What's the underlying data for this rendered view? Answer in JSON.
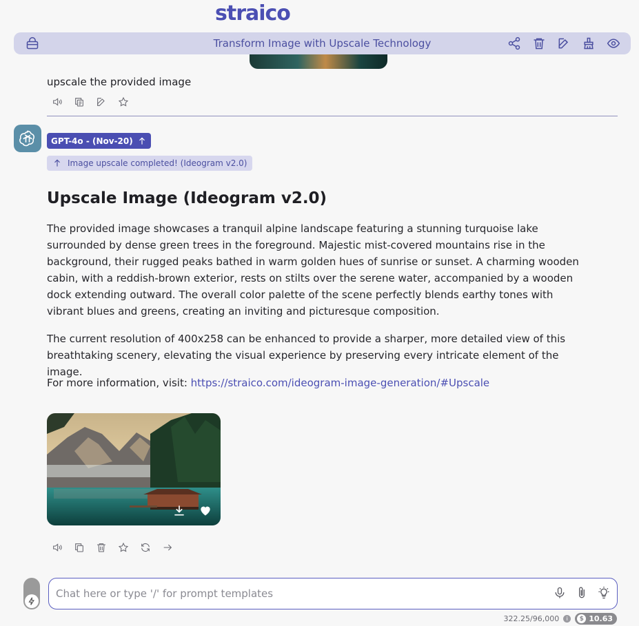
{
  "brand": "straico",
  "header": {
    "title": "Transform Image with Upscale Technology",
    "actions": [
      "share-icon",
      "trash-icon",
      "edit-icon",
      "broom-icon",
      "eye-icon"
    ]
  },
  "user_message": {
    "text": "upscale the provided image",
    "tools": [
      "speaker-icon",
      "copy-icon",
      "edit-icon",
      "star-icon"
    ]
  },
  "assistant": {
    "model_badge": "GPT-4o - (Nov-20)",
    "status_chip": "Image upscale completed! (Ideogram v2.0)",
    "heading": "Upscale Image (Ideogram v2.0)",
    "paragraph1": "The provided image showcases a tranquil alpine landscape featuring a stunning turquoise lake surrounded by dense green trees in the foreground. Majestic mist-covered mountains rise in the background, their rugged peaks bathed in warm golden hues of sunrise or sunset. A charming wooden cabin, with a reddish-brown exterior, rests on stilts over the serene water, accompanied by a wooden dock extending outward. The overall color palette of the scene perfectly blends earthy tones with vibrant blues and greens, creating an inviting and picturesque composition.",
    "paragraph2": "The current resolution of 400x258 can be enhanced to provide a sharper, more detailed view of this breathtaking scenery, elevating the visual experience by preserving every intricate element of the image.",
    "info_prefix": "For more information, visit: ",
    "info_link": "https://straico.com/ideogram-image-generation/#Upscale",
    "tools": [
      "speaker-icon",
      "copy-icon",
      "trash-icon",
      "star-icon",
      "refresh-icon",
      "arrow-right-icon"
    ]
  },
  "composer": {
    "placeholder": "Chat here or type '/' for prompt templates",
    "value": ""
  },
  "footer": {
    "token_count": "322.25/96,000",
    "balance": "10.63"
  },
  "colors": {
    "accent": "#4b4fb3",
    "header_bg": "#d3d4ea",
    "badge_bg": "#4a4eb2",
    "chip_bg": "#d7d7ee",
    "avatar_bg": "#5b8fa8"
  }
}
